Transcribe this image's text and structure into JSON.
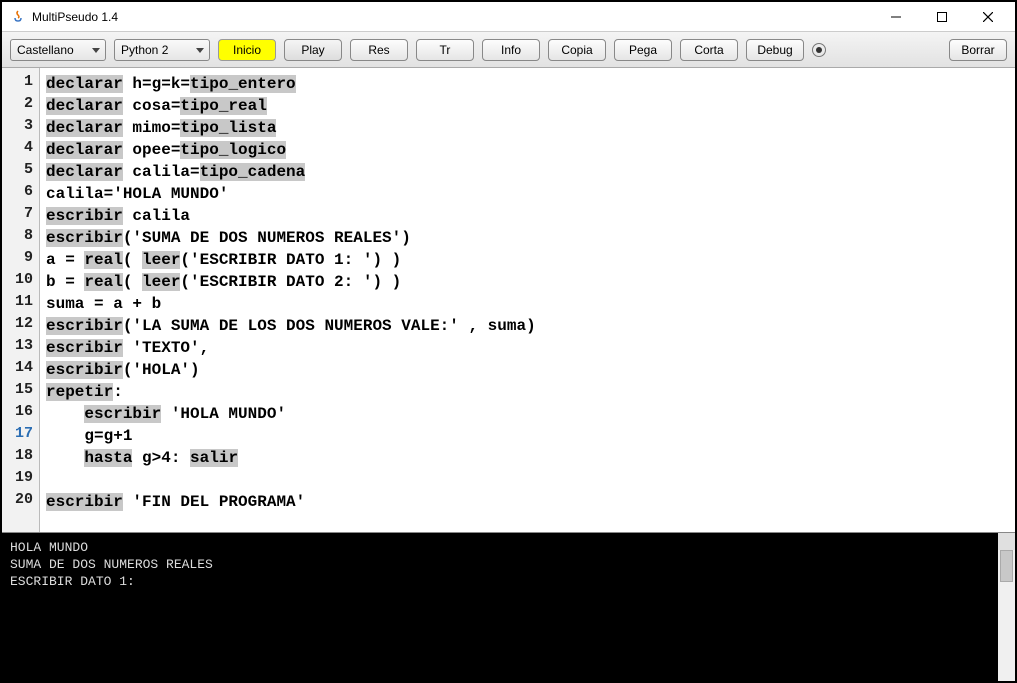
{
  "window": {
    "title": "MultiPseudo 1.4"
  },
  "toolbar": {
    "lang_dropdown": "Castellano",
    "py_dropdown": "Python 2",
    "inicio": "Inicio",
    "play": "Play",
    "res": "Res",
    "tr": "Tr",
    "info": "Info",
    "copia": "Copia",
    "pega": "Pega",
    "corta": "Corta",
    "debug": "Debug",
    "borrar": "Borrar"
  },
  "editor": {
    "active_line": 17,
    "lines": [
      {
        "n": 1,
        "segments": [
          {
            "t": "declarar",
            "hl": true
          },
          {
            "t": " h=g=k="
          },
          {
            "t": "tipo_entero",
            "hl": true
          }
        ]
      },
      {
        "n": 2,
        "segments": [
          {
            "t": "declarar",
            "hl": true
          },
          {
            "t": " cosa="
          },
          {
            "t": "tipo_real",
            "hl": true
          }
        ]
      },
      {
        "n": 3,
        "segments": [
          {
            "t": "declarar",
            "hl": true
          },
          {
            "t": " mimo="
          },
          {
            "t": "tipo_lista",
            "hl": true
          }
        ]
      },
      {
        "n": 4,
        "segments": [
          {
            "t": "declarar",
            "hl": true
          },
          {
            "t": " opee="
          },
          {
            "t": "tipo_logico",
            "hl": true
          }
        ]
      },
      {
        "n": 5,
        "segments": [
          {
            "t": "declarar",
            "hl": true
          },
          {
            "t": " calila="
          },
          {
            "t": "tipo_cadena",
            "hl": true
          }
        ]
      },
      {
        "n": 6,
        "segments": [
          {
            "t": "calila='HOLA MUNDO'"
          }
        ]
      },
      {
        "n": 7,
        "segments": [
          {
            "t": "escribir",
            "hl": true
          },
          {
            "t": " calila"
          }
        ]
      },
      {
        "n": 8,
        "segments": [
          {
            "t": "escribir",
            "hl": true
          },
          {
            "t": "('SUMA DE DOS NUMEROS REALES')"
          }
        ]
      },
      {
        "n": 9,
        "segments": [
          {
            "t": "a = "
          },
          {
            "t": "real",
            "hl": true
          },
          {
            "t": "( "
          },
          {
            "t": "leer",
            "hl": true
          },
          {
            "t": "('ESCRIBIR DATO 1: ') )"
          }
        ]
      },
      {
        "n": 10,
        "segments": [
          {
            "t": "b = "
          },
          {
            "t": "real",
            "hl": true
          },
          {
            "t": "( "
          },
          {
            "t": "leer",
            "hl": true
          },
          {
            "t": "('ESCRIBIR DATO 2: ') )"
          }
        ]
      },
      {
        "n": 11,
        "segments": [
          {
            "t": "suma = a + b"
          }
        ]
      },
      {
        "n": 12,
        "segments": [
          {
            "t": "escribir",
            "hl": true
          },
          {
            "t": "('LA SUMA DE LOS DOS NUMEROS VALE:' , suma)"
          }
        ]
      },
      {
        "n": 13,
        "segments": [
          {
            "t": "escribir",
            "hl": true
          },
          {
            "t": " 'TEXTO',"
          }
        ]
      },
      {
        "n": 14,
        "segments": [
          {
            "t": "escribir",
            "hl": true
          },
          {
            "t": "('HOLA')"
          }
        ]
      },
      {
        "n": 15,
        "segments": [
          {
            "t": "repetir",
            "hl": true
          },
          {
            "t": ":"
          }
        ]
      },
      {
        "n": 16,
        "segments": [
          {
            "t": "    "
          },
          {
            "t": "escribir",
            "hl": true
          },
          {
            "t": " 'HOLA MUNDO'"
          }
        ]
      },
      {
        "n": 17,
        "segments": [
          {
            "t": "    g=g+1"
          }
        ]
      },
      {
        "n": 18,
        "segments": [
          {
            "t": "    "
          },
          {
            "t": "hasta",
            "hl": true
          },
          {
            "t": " g>4: "
          },
          {
            "t": "salir",
            "hl": true
          }
        ]
      },
      {
        "n": 19,
        "segments": [
          {
            "t": ""
          }
        ]
      },
      {
        "n": 20,
        "segments": [
          {
            "t": "escribir",
            "hl": true
          },
          {
            "t": " 'FIN DEL PROGRAMA'"
          }
        ]
      }
    ]
  },
  "console": {
    "output": "HOLA MUNDO\nSUMA DE DOS NUMEROS REALES\nESCRIBIR DATO 1: "
  }
}
